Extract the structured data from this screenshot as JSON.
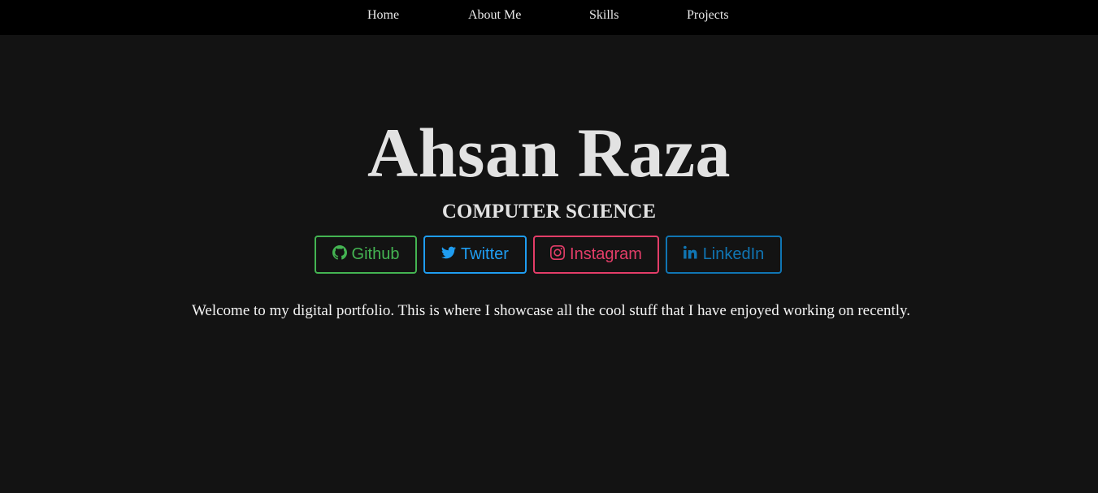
{
  "nav": {
    "items": [
      {
        "label": "Home"
      },
      {
        "label": "About Me"
      },
      {
        "label": "Skills"
      },
      {
        "label": "Projects"
      }
    ]
  },
  "hero": {
    "name": "Ahsan Raza",
    "subtitle": "COMPUTER SCIENCE",
    "intro": "Welcome to my digital portfolio. This is where I showcase all the cool stuff that I have enjoyed working on recently."
  },
  "social": {
    "github": {
      "label": "Github",
      "icon": "github-icon",
      "color": "#44b452"
    },
    "twitter": {
      "label": "Twitter",
      "icon": "twitter-icon",
      "color": "#1f9df1"
    },
    "instagram": {
      "label": "Instagram",
      "icon": "instagram-icon",
      "color": "#e33d68"
    },
    "linkedin": {
      "label": "LinkedIn",
      "icon": "linkedin-icon",
      "color": "#1075b3"
    }
  },
  "colors": {
    "background": "#131313",
    "navbar": "#000000",
    "text": "#e2e2e2"
  }
}
